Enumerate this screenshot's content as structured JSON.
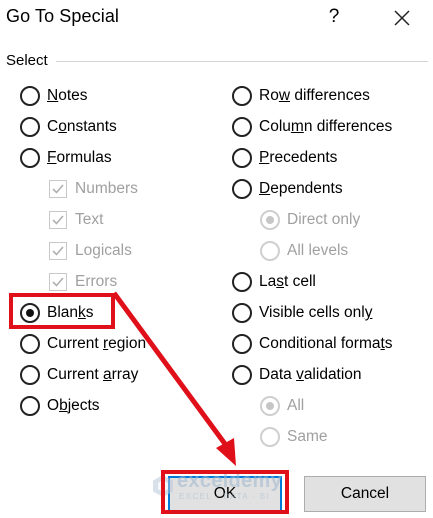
{
  "title": "Go To Special",
  "help_label": "?",
  "group_label": "Select",
  "left_options": [
    {
      "pre": "",
      "u": "N",
      "post": "otes",
      "type": "radio",
      "selected": false,
      "disabled": false
    },
    {
      "pre": "C",
      "u": "o",
      "post": "nstants",
      "type": "radio",
      "selected": false,
      "disabled": false
    },
    {
      "pre": "",
      "u": "F",
      "post": "ormulas",
      "type": "radio",
      "selected": false,
      "disabled": false
    },
    {
      "pre": "Numbers",
      "u": "",
      "post": "",
      "type": "checkbox",
      "checked": true,
      "disabled": true
    },
    {
      "pre": "Text",
      "u": "",
      "post": "",
      "type": "checkbox",
      "checked": true,
      "disabled": true
    },
    {
      "pre": "Logicals",
      "u": "",
      "post": "",
      "type": "checkbox",
      "checked": true,
      "disabled": true
    },
    {
      "pre": "Errors",
      "u": "",
      "post": "",
      "type": "checkbox",
      "checked": true,
      "disabled": true
    },
    {
      "pre": "Blan",
      "u": "k",
      "post": "s",
      "type": "radio",
      "selected": true,
      "disabled": false
    },
    {
      "pre": "Current ",
      "u": "r",
      "post": "egion",
      "type": "radio",
      "selected": false,
      "disabled": false
    },
    {
      "pre": "Current ",
      "u": "a",
      "post": "rray",
      "type": "radio",
      "selected": false,
      "disabled": false
    },
    {
      "pre": "O",
      "u": "b",
      "post": "jects",
      "type": "radio",
      "selected": false,
      "disabled": false
    }
  ],
  "right_options": [
    {
      "pre": "Ro",
      "u": "w",
      "post": " differences",
      "type": "radio",
      "selected": false,
      "disabled": false
    },
    {
      "pre": "Colu",
      "u": "m",
      "post": "n differences",
      "type": "radio",
      "selected": false,
      "disabled": false
    },
    {
      "pre": "",
      "u": "P",
      "post": "recedents",
      "type": "radio",
      "selected": false,
      "disabled": false
    },
    {
      "pre": "",
      "u": "D",
      "post": "ependents",
      "type": "radio",
      "selected": false,
      "disabled": false
    },
    {
      "pre": "Direct only",
      "u": "",
      "post": "",
      "type": "radio",
      "selected": true,
      "disabled": true
    },
    {
      "pre": "All levels",
      "u": "",
      "post": "",
      "type": "radio",
      "selected": false,
      "disabled": true
    },
    {
      "pre": "La",
      "u": "s",
      "post": "t cell",
      "type": "radio",
      "selected": false,
      "disabled": false
    },
    {
      "pre": "Visible cells onl",
      "u": "y",
      "post": "",
      "type": "radio",
      "selected": false,
      "disabled": false
    },
    {
      "pre": "Conditional forma",
      "u": "t",
      "post": "s",
      "type": "radio",
      "selected": false,
      "disabled": false
    },
    {
      "pre": "Data ",
      "u": "v",
      "post": "alidation",
      "type": "radio",
      "selected": false,
      "disabled": false
    },
    {
      "pre": "All",
      "u": "",
      "post": "",
      "type": "radio",
      "selected": true,
      "disabled": true
    },
    {
      "pre": "Same",
      "u": "",
      "post": "",
      "type": "radio",
      "selected": false,
      "disabled": true
    }
  ],
  "buttons": {
    "ok": "OK",
    "cancel": "Cancel"
  },
  "watermark": {
    "name": "exceldemy",
    "sub": "EXCEL · DATA · BI"
  },
  "colors": {
    "highlight": "#e0101a",
    "focus": "#0078d7"
  }
}
